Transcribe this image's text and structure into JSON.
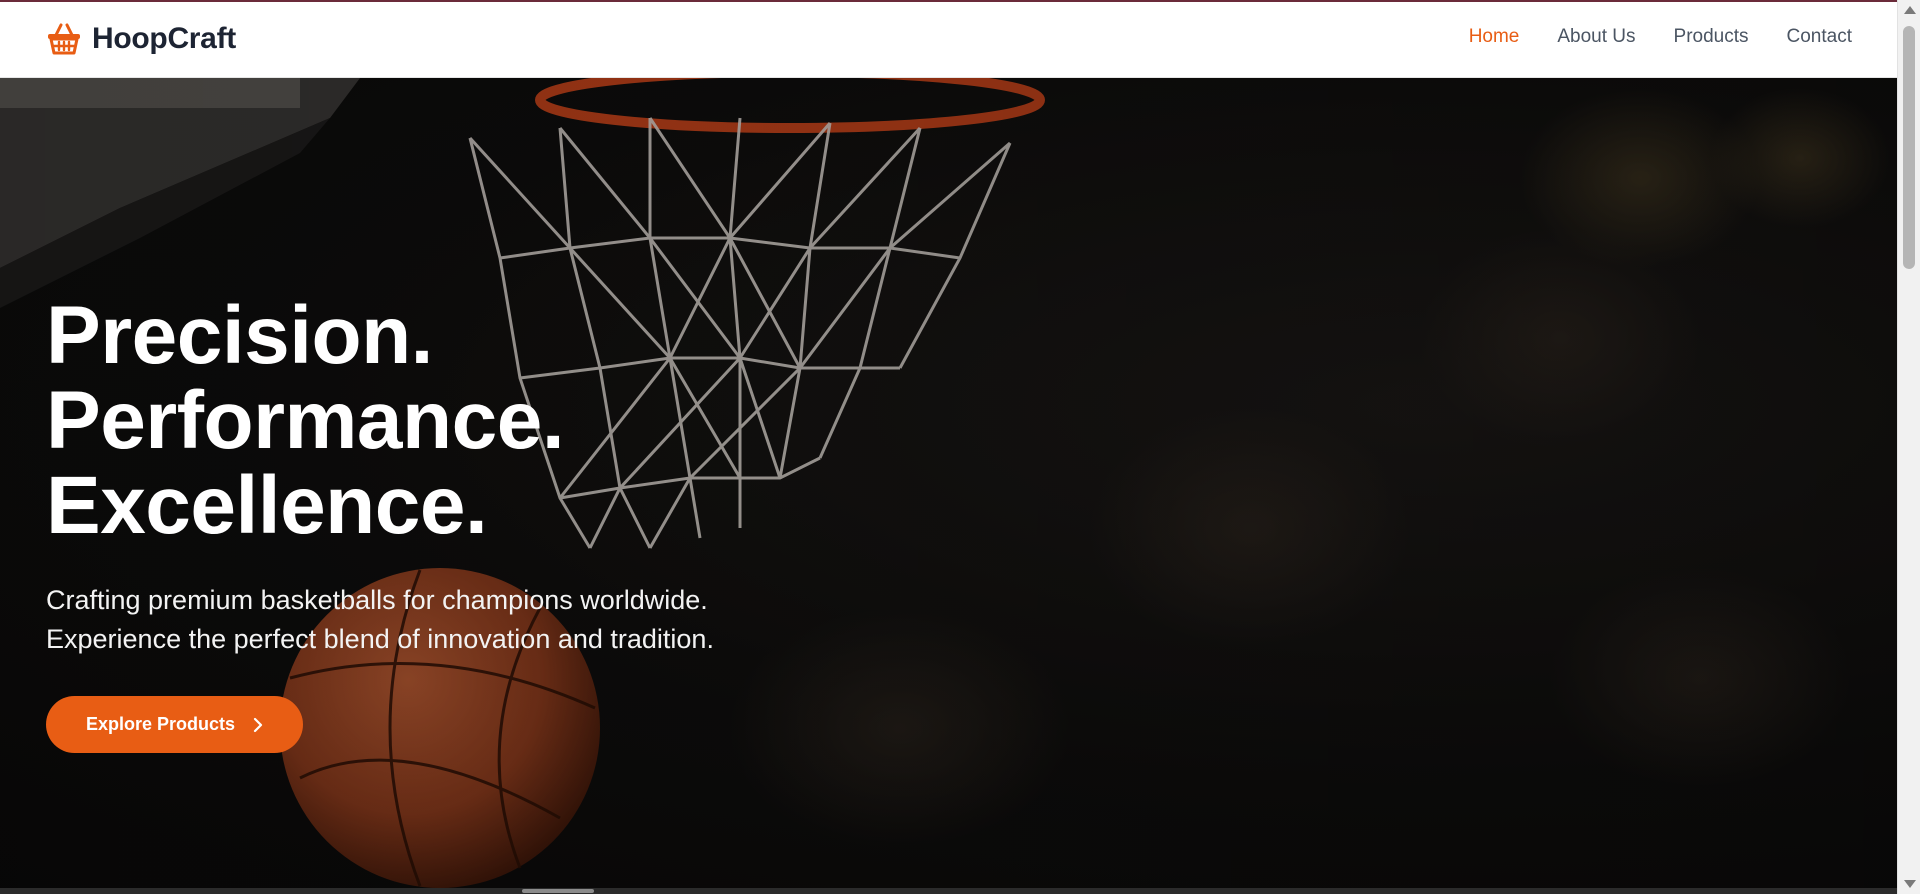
{
  "brand": {
    "name": "HoopCraft",
    "icon": "basket-icon",
    "accent": "#e85d14"
  },
  "nav": {
    "items": [
      {
        "label": "Home",
        "active": true
      },
      {
        "label": "About Us",
        "active": false
      },
      {
        "label": "Products",
        "active": false
      },
      {
        "label": "Contact",
        "active": false
      }
    ]
  },
  "hero": {
    "headline": [
      "Precision.",
      "Performance.",
      "Excellence."
    ],
    "subtitle": [
      "Crafting premium basketballs for champions worldwide.",
      "Experience the perfect blend of innovation and tradition."
    ],
    "cta_label": "Explore Products",
    "cta_icon": "chevron-right-icon",
    "background": "basketball-hoop-and-ball-photo"
  },
  "colors": {
    "accent": "#e85d14",
    "nav_text": "#4b5563",
    "brand_text": "#1d2433"
  }
}
